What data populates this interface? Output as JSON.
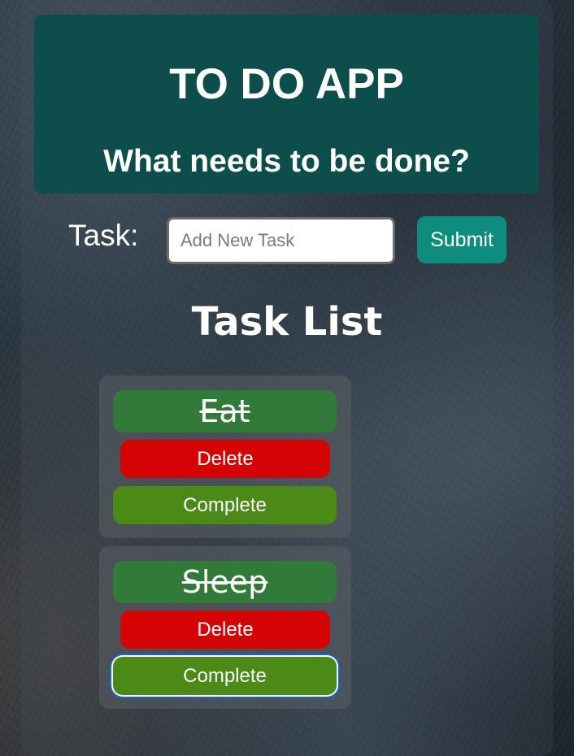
{
  "header": {
    "title": "TO DO APP",
    "subtitle": "What needs to be done?"
  },
  "form": {
    "task_label": "Task:",
    "input_value": "",
    "input_placeholder": "Add New Task",
    "submit_label": "Submit"
  },
  "task_list": {
    "title": "Task List",
    "tasks": [
      {
        "name": "Eat",
        "completed": true,
        "delete_label": "Delete",
        "complete_label": "Complete"
      },
      {
        "name": "Sleep",
        "completed": true,
        "delete_label": "Delete",
        "complete_label": "Complete",
        "complete_button_focused": true
      }
    ]
  },
  "colors": {
    "header_bg": "#0d4d4b",
    "submit_bg": "#0e8c7d",
    "task_name_bg": "#317a3a",
    "delete_bg": "#d40404",
    "complete_bg": "#4b8a17",
    "focus_ring": "#1d62c8"
  }
}
